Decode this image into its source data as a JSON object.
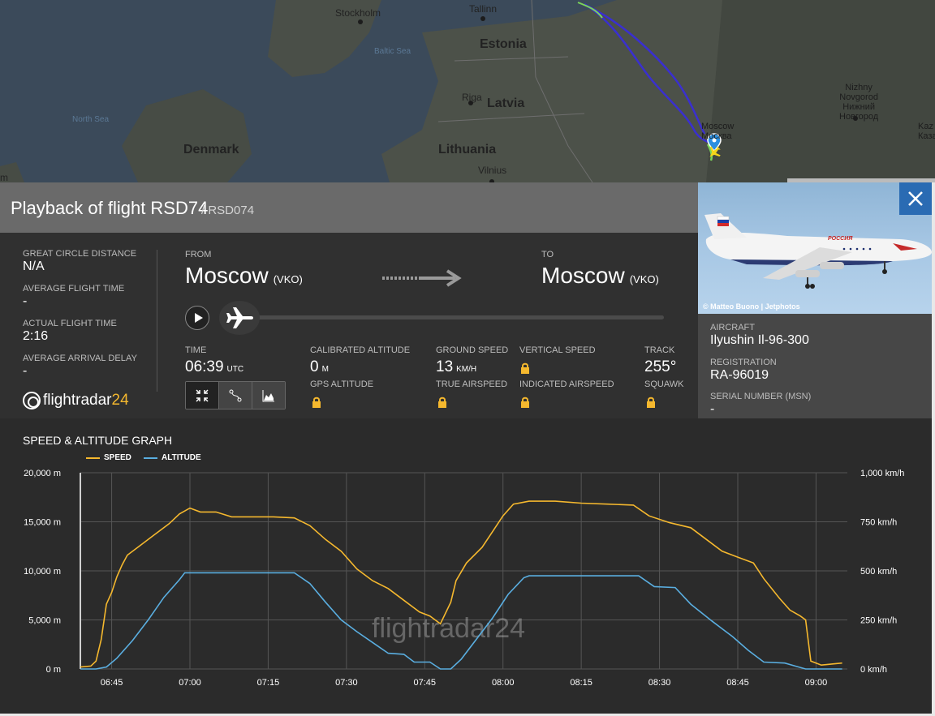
{
  "map": {
    "labels": {
      "stockholm": "Stockholm",
      "tallinn": "Tallinn",
      "estonia": "Estonia",
      "baltic_sea": "Baltic Sea",
      "riga": "Riga",
      "latvia": "Latvia",
      "north_sea": "North Sea",
      "denmark": "Denmark",
      "lithuania": "Lithuania",
      "vilnius": "Vilnius",
      "moscow_en": "Moscow",
      "moscow_ru": "Москва",
      "nizhny_1": "Nizhny",
      "nizhny_2": "Novgorod",
      "nizhny_3": "Нижний",
      "nizhny_4": "Новгород",
      "kaz_1": "Kaz",
      "kaz_2": "Казан",
      "edge_m": "m"
    }
  },
  "header": {
    "title": "Playback of flight RSD74",
    "callsign": "/ RSD074"
  },
  "stats": {
    "great_circle_label": "GREAT CIRCLE DISTANCE",
    "great_circle_value": "N/A",
    "avg_flight_time_label": "AVERAGE FLIGHT TIME",
    "avg_flight_time_value": "-",
    "actual_flight_time_label": "ACTUAL FLIGHT TIME",
    "actual_flight_time_value": "2:16",
    "avg_arrival_delay_label": "AVERAGE ARRIVAL DELAY",
    "avg_arrival_delay_value": "-"
  },
  "logo": {
    "text": "flightradar",
    "num": "24"
  },
  "route": {
    "from_label": "FROM",
    "from_city": "Moscow",
    "from_code": "(VKO)",
    "to_label": "TO",
    "to_city": "Moscow",
    "to_code": "(VKO)"
  },
  "playback": {
    "progress": 0
  },
  "telemetry": {
    "time_label": "TIME",
    "time_value": "06:39",
    "time_unit": "UTC",
    "cal_alt_label": "CALIBRATED ALTITUDE",
    "cal_alt_value": "0",
    "cal_alt_unit": "M",
    "gps_alt_label": "GPS ALTITUDE",
    "ground_speed_label": "GROUND SPEED",
    "ground_speed_value": "13",
    "ground_speed_unit": "KM/H",
    "true_airspeed_label": "TRUE AIRSPEED",
    "vertical_speed_label": "VERTICAL SPEED",
    "indicated_airspeed_label": "INDICATED AIRSPEED",
    "track_label": "TRACK",
    "track_value": "255°",
    "squawk_label": "SQUAWK"
  },
  "aircraft": {
    "photo_credit": "© Matteo Buono | Jetphotos",
    "aircraft_label": "AIRCRAFT",
    "aircraft_value": "Ilyushin Il-96-300",
    "registration_label": "REGISTRATION",
    "registration_value": "RA-96019",
    "serial_label": "SERIAL NUMBER (MSN)",
    "serial_value": "-",
    "livery_text": "РОССИЯ"
  },
  "graph": {
    "title": "SPEED & ALTITUDE GRAPH",
    "legend_speed": "SPEED",
    "legend_altitude": "ALTITUDE",
    "watermark": "flightradar24"
  },
  "colors": {
    "speed": "#f5b82e",
    "altitude": "#5aaee0",
    "close_button": "#2a6bb3"
  },
  "chart_data": {
    "type": "line",
    "title": "SPEED & ALTITUDE GRAPH",
    "x_tick_labels": [
      "06:45",
      "07:00",
      "07:15",
      "07:30",
      "07:45",
      "08:00",
      "08:15",
      "08:30",
      "08:45",
      "09:00"
    ],
    "y_left_tick_labels": [
      "20,000 m",
      "15,000 m",
      "10,000 m",
      "5,000 m",
      "0 m"
    ],
    "y_right_tick_labels": [
      "1,000 km/h",
      "750 km/h",
      "500 km/h",
      "250 km/h",
      "0 km/h"
    ],
    "y_left_range": [
      0,
      20000
    ],
    "y_right_range": [
      0,
      1000
    ],
    "x_range_minutes_utc": [
      "06:39",
      "09:06"
    ],
    "series": [
      {
        "name": "SPEED",
        "unit": "km/h",
        "points": [
          [
            "06:39",
            10
          ],
          [
            "06:41",
            15
          ],
          [
            "06:42",
            40
          ],
          [
            "06:43",
            150
          ],
          [
            "06:44",
            330
          ],
          [
            "06:45",
            390
          ],
          [
            "06:46",
            470
          ],
          [
            "06:47",
            530
          ],
          [
            "06:48",
            580
          ],
          [
            "06:50",
            620
          ],
          [
            "06:53",
            680
          ],
          [
            "06:56",
            740
          ],
          [
            "06:58",
            790
          ],
          [
            "07:00",
            820
          ],
          [
            "07:02",
            800
          ],
          [
            "07:05",
            800
          ],
          [
            "07:08",
            775
          ],
          [
            "07:12",
            775
          ],
          [
            "07:16",
            775
          ],
          [
            "07:20",
            770
          ],
          [
            "07:23",
            730
          ],
          [
            "07:26",
            660
          ],
          [
            "07:29",
            600
          ],
          [
            "07:32",
            510
          ],
          [
            "07:35",
            450
          ],
          [
            "07:38",
            410
          ],
          [
            "07:41",
            350
          ],
          [
            "07:44",
            290
          ],
          [
            "07:46",
            270
          ],
          [
            "07:48",
            230
          ],
          [
            "07:50",
            340
          ],
          [
            "07:51",
            450
          ],
          [
            "07:53",
            540
          ],
          [
            "07:56",
            620
          ],
          [
            "07:58",
            700
          ],
          [
            "08:00",
            780
          ],
          [
            "08:02",
            840
          ],
          [
            "08:05",
            855
          ],
          [
            "08:10",
            855
          ],
          [
            "08:15",
            845
          ],
          [
            "08:20",
            840
          ],
          [
            "08:25",
            835
          ],
          [
            "08:28",
            780
          ],
          [
            "08:32",
            745
          ],
          [
            "08:36",
            720
          ],
          [
            "08:39",
            660
          ],
          [
            "08:42",
            600
          ],
          [
            "08:45",
            570
          ],
          [
            "08:48",
            540
          ],
          [
            "08:50",
            460
          ],
          [
            "08:53",
            360
          ],
          [
            "08:55",
            300
          ],
          [
            "08:57",
            270
          ],
          [
            "08:58",
            250
          ],
          [
            "08:59",
            40
          ],
          [
            "09:01",
            20
          ],
          [
            "09:03",
            25
          ],
          [
            "09:05",
            30
          ]
        ]
      },
      {
        "name": "ALTITUDE",
        "unit": "m",
        "points": [
          [
            "06:39",
            0
          ],
          [
            "06:42",
            0
          ],
          [
            "06:44",
            200
          ],
          [
            "06:46",
            1100
          ],
          [
            "06:49",
            2900
          ],
          [
            "06:52",
            5000
          ],
          [
            "06:55",
            7300
          ],
          [
            "06:58",
            9100
          ],
          [
            "06:59",
            9800
          ],
          [
            "07:05",
            9800
          ],
          [
            "07:15",
            9800
          ],
          [
            "07:20",
            9800
          ],
          [
            "07:23",
            8700
          ],
          [
            "07:26",
            6800
          ],
          [
            "07:29",
            5000
          ],
          [
            "07:32",
            3800
          ],
          [
            "07:35",
            2700
          ],
          [
            "07:38",
            1600
          ],
          [
            "07:41",
            1500
          ],
          [
            "07:43",
            700
          ],
          [
            "07:46",
            700
          ],
          [
            "07:48",
            0
          ],
          [
            "07:50",
            0
          ],
          [
            "07:52",
            1000
          ],
          [
            "07:55",
            3100
          ],
          [
            "07:58",
            5200
          ],
          [
            "08:01",
            7600
          ],
          [
            "08:04",
            9300
          ],
          [
            "08:05",
            9500
          ],
          [
            "08:15",
            9500
          ],
          [
            "08:26",
            9500
          ],
          [
            "08:29",
            8400
          ],
          [
            "08:33",
            8300
          ],
          [
            "08:36",
            6600
          ],
          [
            "08:40",
            4900
          ],
          [
            "08:44",
            3300
          ],
          [
            "08:47",
            1900
          ],
          [
            "08:50",
            700
          ],
          [
            "08:54",
            600
          ],
          [
            "08:56",
            300
          ],
          [
            "08:58",
            0
          ],
          [
            "09:05",
            0
          ]
        ]
      }
    ],
    "grid": true,
    "legend_position": "top-left"
  }
}
